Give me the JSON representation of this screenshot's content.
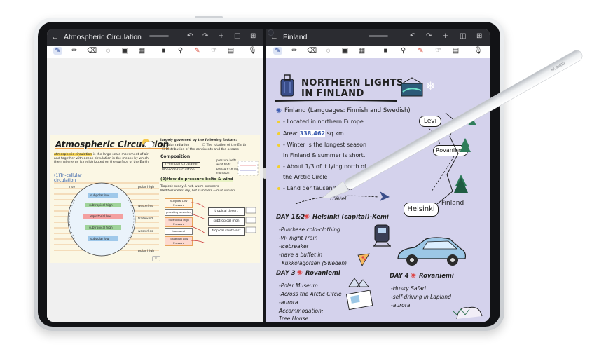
{
  "left_pane": {
    "title": "Atmospheric Circulation",
    "note": {
      "title": "Atmospheric Circulation",
      "intro_highlight": "Atmospheric circulation",
      "intro_rest": "is the large-scale movement of air and together with ocean circulation is the means by which thermal energy is redistributed on the surface of the Earth",
      "section_cells": "(1)Tri-cellular circulation",
      "diagram_labels": [
        "polar high",
        "subpolar low",
        "subtropical high",
        "equatorial low",
        "subtropical high",
        "subpolar low",
        "polar high"
      ],
      "side_labels": [
        "polar easterlies",
        "prevailing westerlies",
        "tradewind",
        "tradewind",
        "prevailing westerlies",
        "polar easterlies"
      ],
      "factors_title": "largely governed by the following factors:",
      "factor_1": "Solar radiation",
      "factor_2": "The rotation of the Earth",
      "factor_3": "Distribution of the continents and the oceans",
      "composition_title": "Composition",
      "tri_cell": "Tri-cellular circulation",
      "monsoon": "Monsoon Circulation",
      "comp_labels": [
        "pressure belts",
        "wind belts",
        "pressure center",
        "monsoon"
      ],
      "pressure_title": "(2)How do pressure belts & wind",
      "tropical": "Tropical: sunny & hot, warm summers",
      "mediterranean": "Mediterranean: dry, hot summers & mild winters",
      "table_left": [
        "Subpolar Low Pressure",
        "prevailing westerlies",
        "Subtropical High Pressure",
        "tradewind",
        "Equatorial Low Pressure"
      ],
      "table_right": [
        "tropical desert",
        "subtropical mon",
        "tropical rainforest"
      ],
      "page_indicator": "1/1"
    }
  },
  "right_pane": {
    "title": "Finland",
    "note": {
      "heading_1": "NORTHERN LIGHTS",
      "heading_2": "IN FINLAND",
      "lead": "Finland (Languages: Finnish and Swedish)",
      "bullets": [
        "Located in northern Europe.",
        "Area: 338,462 sq km",
        "Winter is the longest season",
        "in Finland & summer is short.",
        "About 1/3 of it lying north of",
        "the Arctic Circle",
        "Land der tausend Seen"
      ],
      "area_value": "338,462",
      "travel": "Travel",
      "tags": [
        "Levi",
        "Rovaniemi",
        "Helsinki"
      ],
      "map_label": "Finland",
      "day12_title": "DAY 1&2",
      "day12_place": "Helsinki (capital)-Kemi",
      "day12_items": [
        "Purchase cold-clothing",
        "VR night Train",
        "icebreaker",
        "have a buffet in",
        "Kukkolagorsen (Sweden)"
      ],
      "day3_title": "DAY 3",
      "day3_place": "Rovaniemi",
      "day3_items": [
        "Polar Museum",
        "Across the Arctic Circle",
        "aurora",
        "Accommodation:",
        "Tree House"
      ],
      "day4_title": "DAY 4",
      "day4_place": "Rovaniemi",
      "day4_items": [
        "Husky Safari",
        "self-driving in Lapland",
        "aurora"
      ]
    }
  },
  "stylus_brand": "HUAWEI",
  "colors": {
    "left_note_bg": "#fbf7e4",
    "right_note_bg": "#d4d2ec",
    "highlight": "#f9d85c",
    "titlebar": "#2b2c31"
  }
}
